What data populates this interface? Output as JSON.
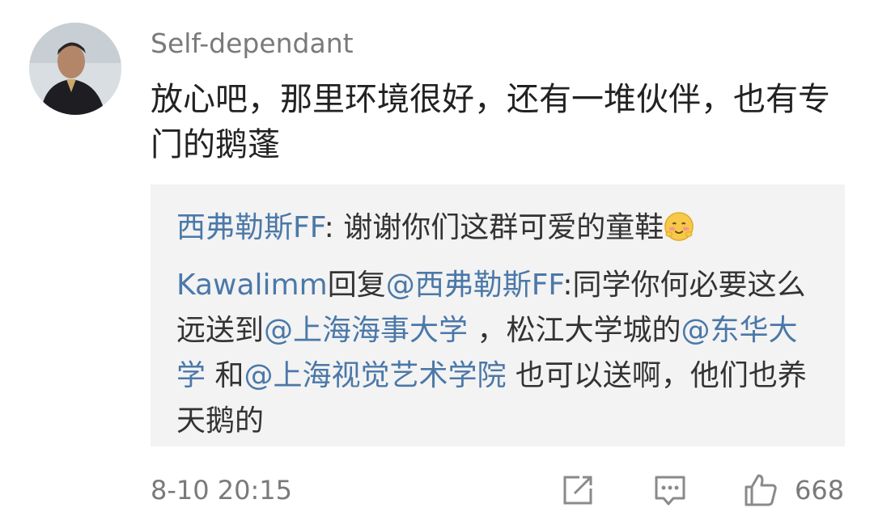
{
  "comment": {
    "username": "Self-dependant",
    "text": "放心吧，那里环境很好，还有一堆伙伴，也有专门的鹅蓬"
  },
  "replies": {
    "r1_author": "西弗勒斯FF",
    "r1_sep": ": ",
    "r1_text": "谢谢你们这群可爱的童鞋",
    "r2_author": "Kawalimm",
    "r2_reply_word": "回复",
    "r2_mention1": "@西弗勒斯FF",
    "r2_text1": ":同学你何必要这么远送到",
    "r2_mention2": "@上海海事大学",
    "r2_text2": " ，松江大学城的",
    "r2_mention3": "@东华大学",
    "r2_text3": " 和",
    "r2_mention4": "@上海视觉艺术学院",
    "r2_text4": " 也可以送啊，他们也养天鹅的"
  },
  "footer": {
    "timestamp": "8-10 20:15",
    "like_count": "668",
    "icons": [
      "share-icon",
      "comment-icon",
      "like-icon"
    ]
  },
  "colors": {
    "link": "#4b78a8",
    "muted": "#7a7a7a",
    "reply_bg": "#f3f3f3"
  }
}
